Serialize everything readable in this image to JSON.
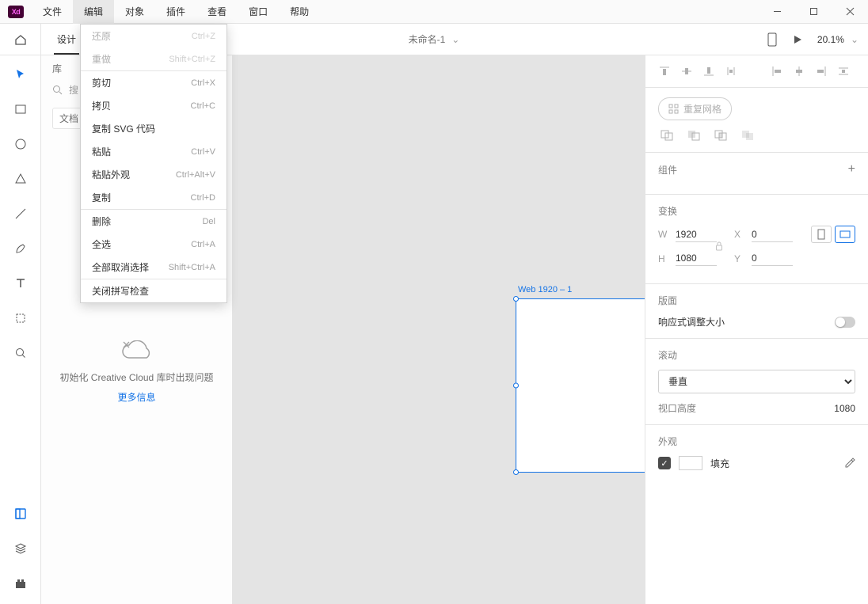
{
  "app_icon_text": "Xd",
  "menu": {
    "file": "文件",
    "edit": "编辑",
    "object": "对象",
    "plugins": "插件",
    "view": "查看",
    "window": "窗口",
    "help": "帮助"
  },
  "dropdown": {
    "undo": "还原",
    "undo_sc": "Ctrl+Z",
    "redo": "重做",
    "redo_sc": "Shift+Ctrl+Z",
    "cut": "剪切",
    "cut_sc": "Ctrl+X",
    "copy": "拷贝",
    "copy_sc": "Ctrl+C",
    "copy_svg": "复制 SVG 代码",
    "paste": "粘贴",
    "paste_sc": "Ctrl+V",
    "paste_app": "粘贴外观",
    "paste_app_sc": "Ctrl+Alt+V",
    "duplicate": "复制",
    "duplicate_sc": "Ctrl+D",
    "delete": "删除",
    "delete_sc": "Del",
    "select_all": "全选",
    "select_all_sc": "Ctrl+A",
    "deselect": "全部取消选择",
    "deselect_sc": "Shift+Ctrl+A",
    "spell": "关闭拼写检查"
  },
  "mode_tabs": {
    "design": "设计"
  },
  "doc_title": "未命名-1",
  "zoom": "20.1%",
  "left_panel": {
    "tab": "库",
    "search_placeholder": "搜",
    "tag": "文档",
    "cc_msg": "初始化 Creative Cloud 库时出现问题",
    "more": "更多信息"
  },
  "artboard": {
    "label": "Web 1920 – 1"
  },
  "right_panel": {
    "repeat": "重复网格",
    "components": "组件",
    "transform": "变换",
    "w_label": "W",
    "w_val": "1920",
    "h_label": "H",
    "h_val": "1080",
    "x_label": "X",
    "x_val": "0",
    "y_label": "Y",
    "y_val": "0",
    "layout_head": "版面",
    "responsive": "响应式调整大小",
    "scroll_head": "滚动",
    "scroll_value": "垂直",
    "viewport_label": "视口高度",
    "viewport_val": "1080",
    "appearance": "外观",
    "fill": "填充"
  }
}
